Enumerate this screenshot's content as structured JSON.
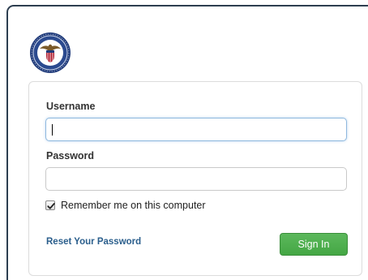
{
  "logo": {
    "icon": "dol-seal-icon",
    "colors": {
      "ring": "#1f3a7a",
      "field": "#ffffff",
      "shield": "#b22234",
      "eagle": "#7a5a2a"
    }
  },
  "form": {
    "username_label": "Username",
    "username_value": "",
    "password_label": "Password",
    "password_value": "",
    "remember_label": "Remember me on this computer",
    "remember_checked": true,
    "reset_link": "Reset Your Password",
    "signin_button": "Sign In"
  },
  "colors": {
    "frame_border": "#2d3e50",
    "link": "#2a5e8c",
    "button": "#4cae4c",
    "focus_border": "#8fb9de"
  }
}
